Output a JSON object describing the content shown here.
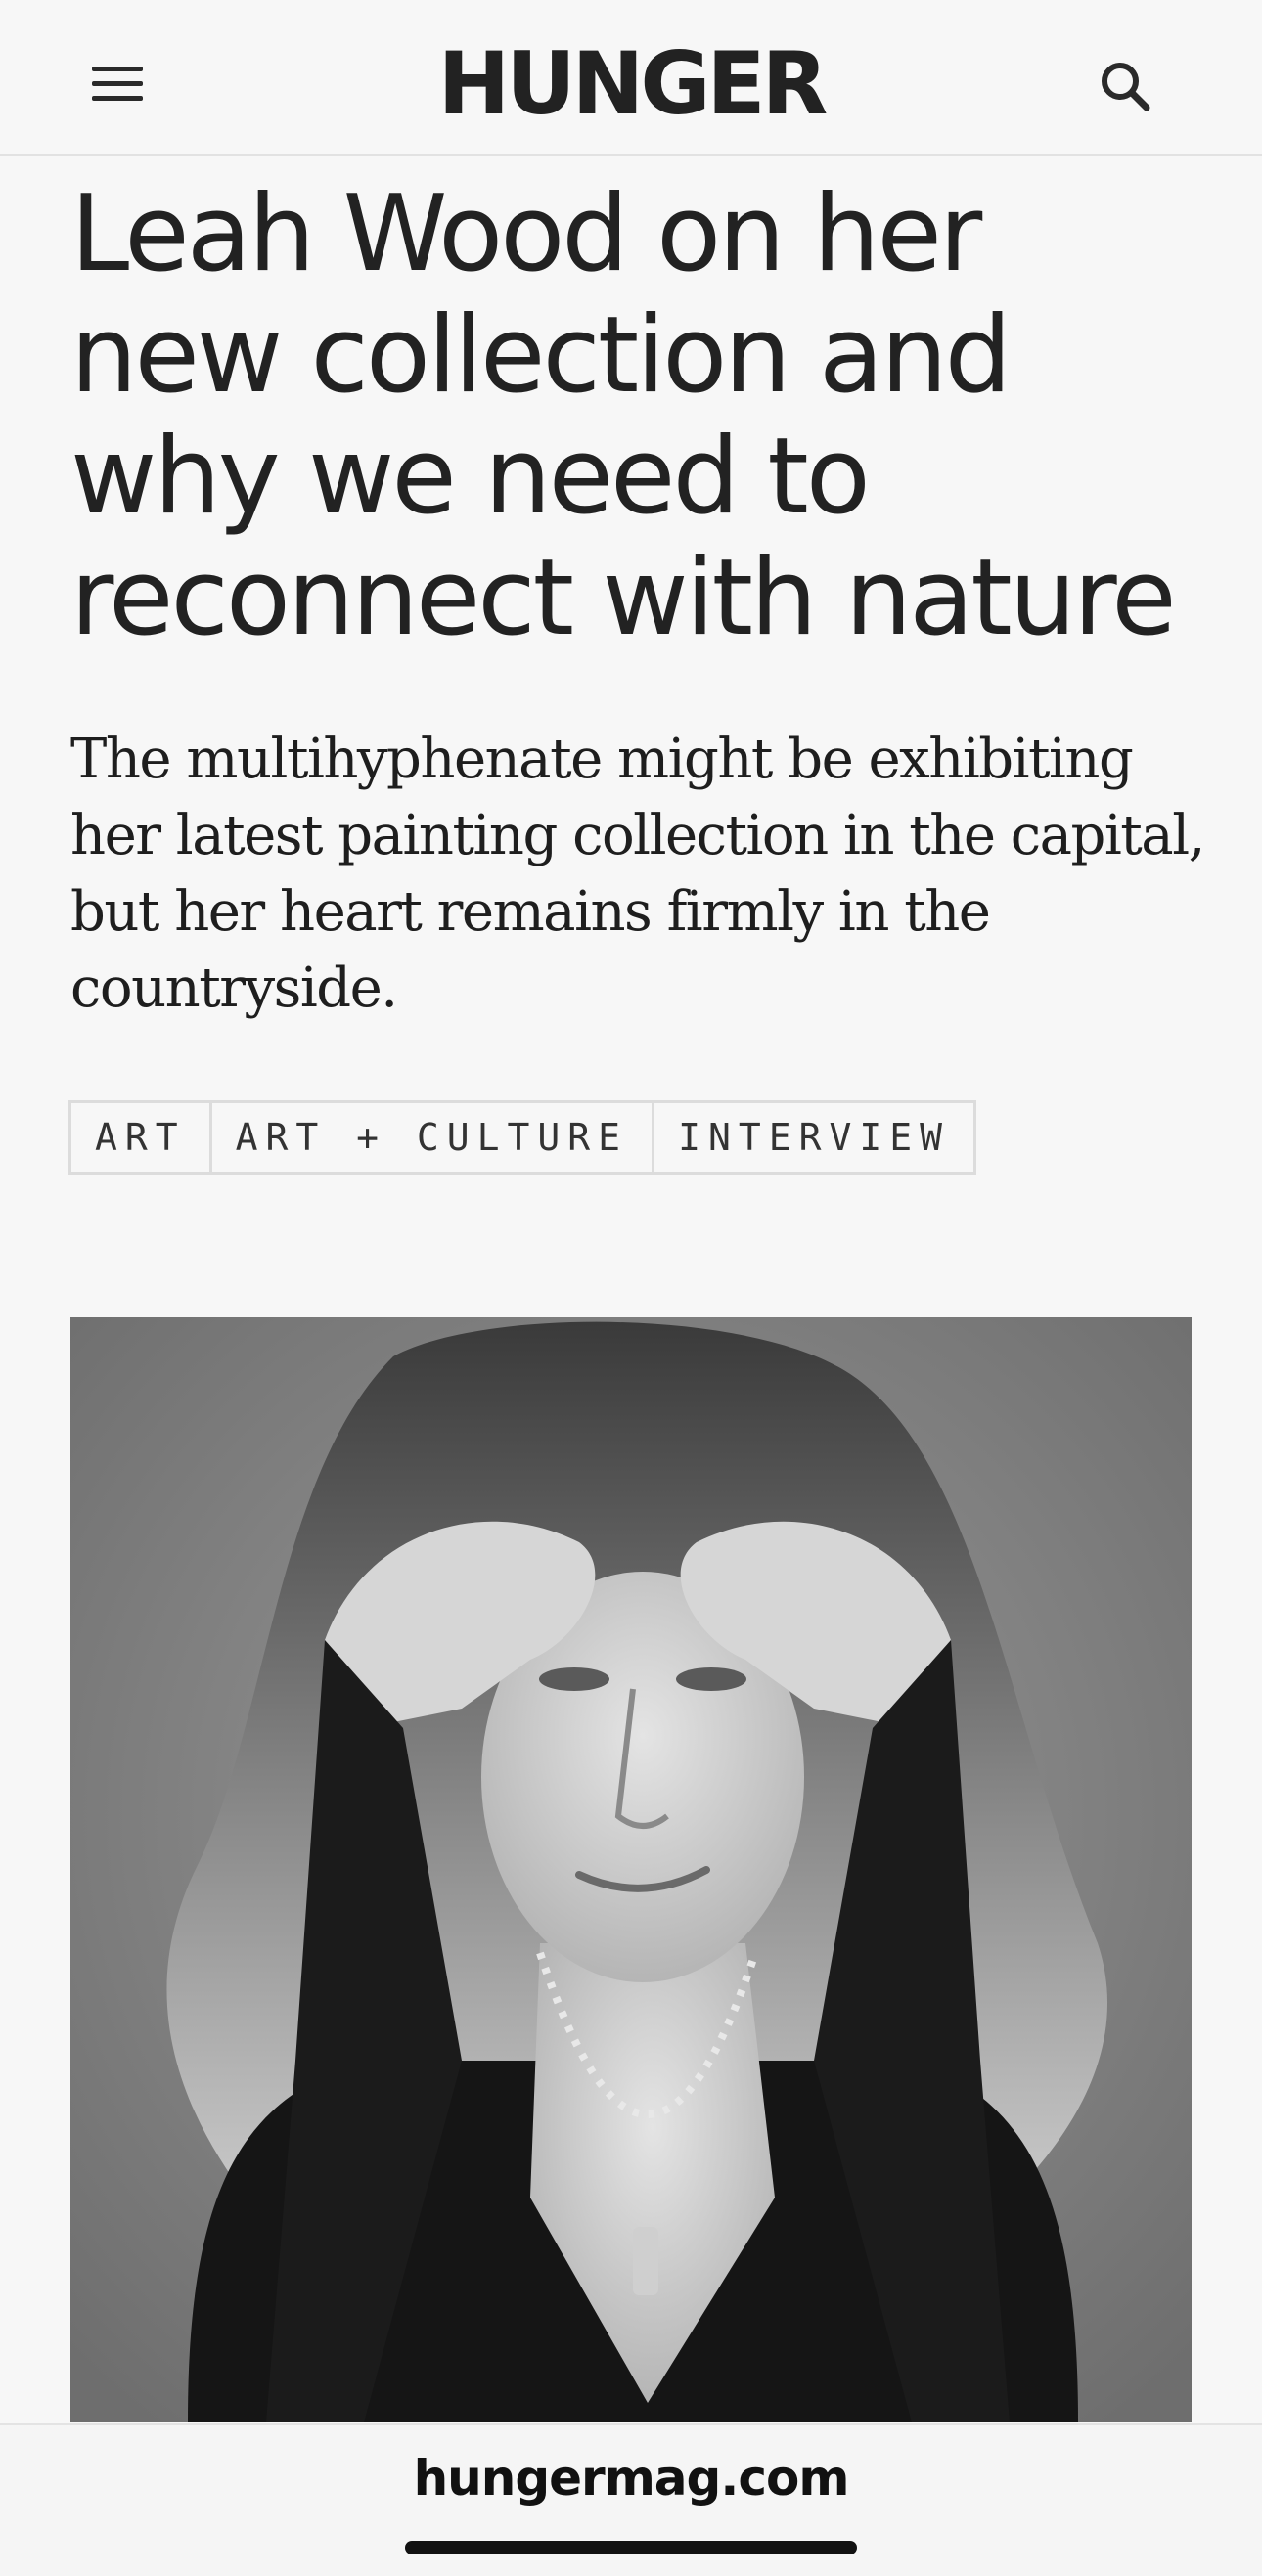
{
  "header": {
    "logo": "HUNGER",
    "menu_icon": "hamburger-menu-icon",
    "search_icon": "search-icon"
  },
  "article": {
    "headline": "Leah Wood on her new collection and why we need to reconnect with nature",
    "standfirst": "The multihyphenate might be exhibiting her latest painting collection in the capital, but her heart remains firmly in the countryside.",
    "tags": [
      "ART",
      "ART + CULTURE",
      "INTERVIEW"
    ]
  },
  "browser": {
    "url": "hungermag.com"
  },
  "colors": {
    "background": "#f7f7f7",
    "text": "#1b1b1b",
    "divider": "#e2e2e2",
    "tag_border": "#dcdcdc"
  }
}
